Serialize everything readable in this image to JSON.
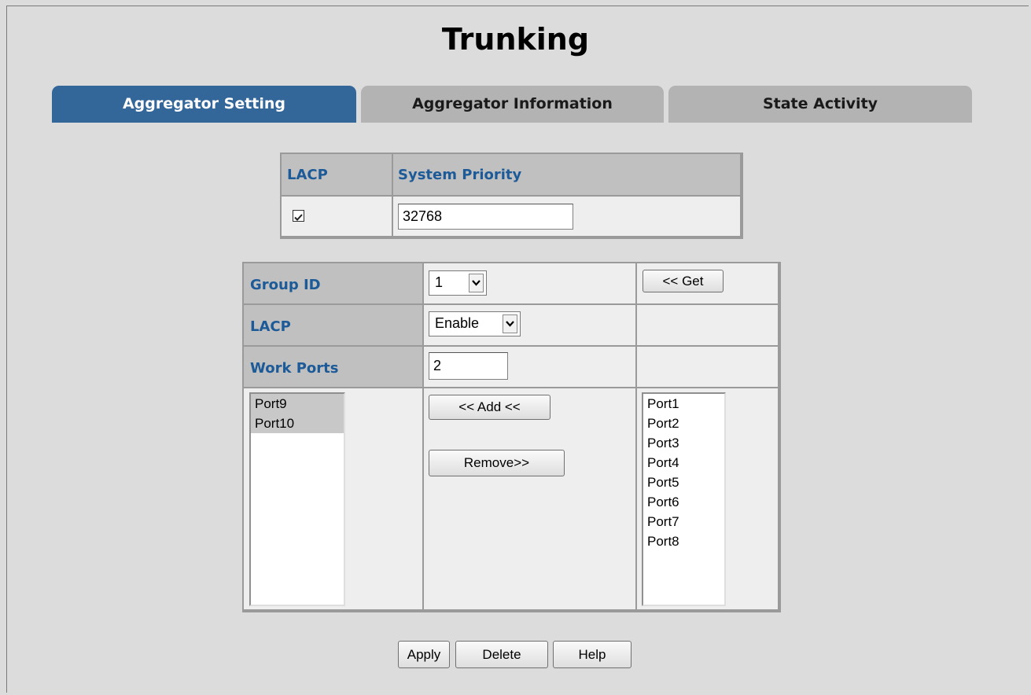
{
  "title": "Trunking",
  "tabs": [
    {
      "label": "Aggregator Setting",
      "active": true
    },
    {
      "label": "Aggregator Information",
      "active": false
    },
    {
      "label": "State Activity",
      "active": false
    }
  ],
  "system_table": {
    "col_lacp": "LACP",
    "col_priority": "System Priority",
    "lacp_checked": true,
    "priority_value": "32768"
  },
  "group_table": {
    "group_id_label": "Group ID",
    "group_id_value": "1",
    "get_button": "<< Get",
    "lacp_label": "LACP",
    "lacp_value": "Enable",
    "work_ports_label": "Work Ports",
    "work_ports_value": "2",
    "add_button": "<< Add <<",
    "remove_button": "Remove>>",
    "member_ports": [
      "Port9",
      "Port10"
    ],
    "available_ports": [
      "Port1",
      "Port2",
      "Port3",
      "Port4",
      "Port5",
      "Port6",
      "Port7",
      "Port8"
    ]
  },
  "actions": {
    "apply": "Apply",
    "delete": "Delete",
    "help": "Help"
  },
  "colors": {
    "active_tab": "#336699",
    "inactive_tab": "#b3b3b3",
    "label_blue": "#1d5a98",
    "background": "#dcdcdc"
  }
}
